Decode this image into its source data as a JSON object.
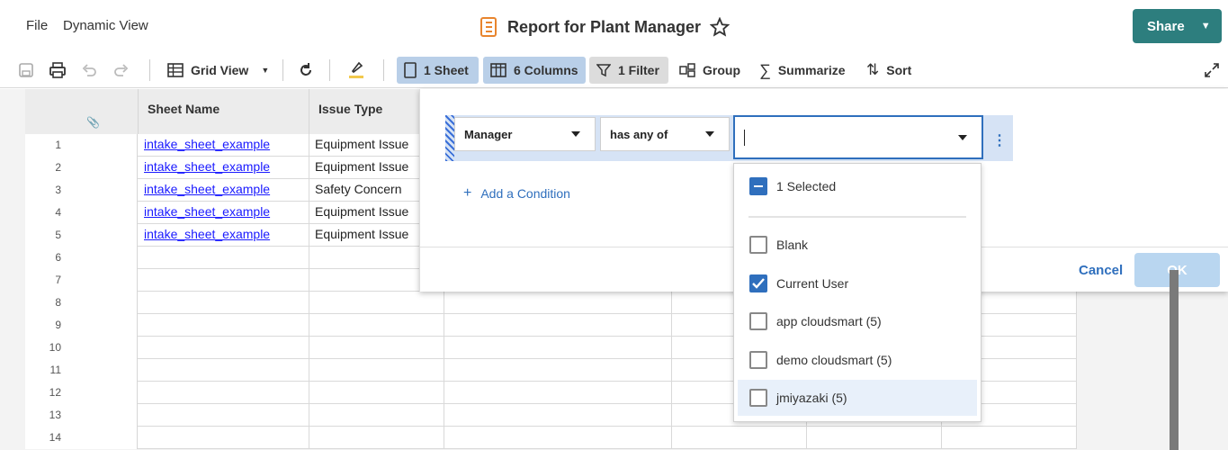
{
  "menu": {
    "file": "File",
    "dynamic_view": "Dynamic View"
  },
  "title": "Report for Plant Manager",
  "share_label": "Share",
  "toolbar": {
    "grid_view": "Grid View",
    "sheet": "1 Sheet",
    "columns": "6 Columns",
    "filter": "1 Filter",
    "group": "Group",
    "summarize": "Summarize",
    "sort": "Sort"
  },
  "columns": {
    "sheet_name": "Sheet Name",
    "issue_type": "Issue Type"
  },
  "rows": [
    {
      "num": "1",
      "sheet": "intake_sheet_example",
      "issue": "Equipment Issue"
    },
    {
      "num": "2",
      "sheet": "intake_sheet_example",
      "issue": "Equipment Issue"
    },
    {
      "num": "3",
      "sheet": "intake_sheet_example",
      "issue": "Safety Concern"
    },
    {
      "num": "4",
      "sheet": "intake_sheet_example",
      "issue": "Equipment Issue"
    },
    {
      "num": "5",
      "sheet": "intake_sheet_example",
      "issue": "Equipment Issue"
    },
    {
      "num": "6",
      "sheet": "",
      "issue": ""
    },
    {
      "num": "7",
      "sheet": "",
      "issue": ""
    },
    {
      "num": "8",
      "sheet": "",
      "issue": ""
    },
    {
      "num": "9",
      "sheet": "",
      "issue": ""
    },
    {
      "num": "10",
      "sheet": "",
      "issue": ""
    },
    {
      "num": "11",
      "sheet": "",
      "issue": ""
    },
    {
      "num": "12",
      "sheet": "",
      "issue": ""
    },
    {
      "num": "13",
      "sheet": "",
      "issue": ""
    },
    {
      "num": "14",
      "sheet": "",
      "issue": ""
    }
  ],
  "filter": {
    "field": "Manager",
    "operator": "has any of",
    "value": "",
    "add_condition": "Add a Condition",
    "cancel": "Cancel",
    "ok": "OK"
  },
  "options": {
    "selected_summary": "1 Selected",
    "items": [
      {
        "label": "Blank",
        "checked": false
      },
      {
        "label": "Current User",
        "checked": true
      },
      {
        "label": "app cloudsmart (5)",
        "checked": false
      },
      {
        "label": "demo cloudsmart (5)",
        "checked": false
      },
      {
        "label": "jmiyazaki (5)",
        "checked": false
      }
    ]
  },
  "colors": {
    "accent": "#2f6fbd",
    "share": "#2d7e7e",
    "ok_disabled": "#b9d6f0"
  }
}
